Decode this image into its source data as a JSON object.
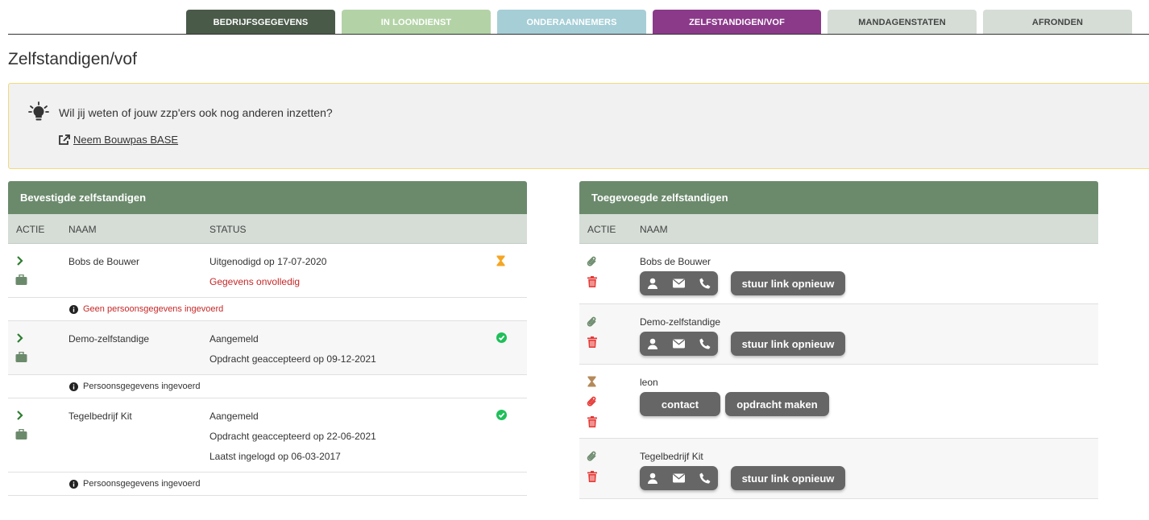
{
  "tabs": [
    {
      "label": "BEDRIJFSGEGEVENS"
    },
    {
      "label": "IN LOONDIENST"
    },
    {
      "label": "ONDERAANNEMERS"
    },
    {
      "label": "ZELFSTANDIGEN/VOF"
    },
    {
      "label": "MANDAGENSTATEN"
    },
    {
      "label": "AFRONDEN"
    }
  ],
  "page_title": "Zelfstandigen/vof",
  "notice": {
    "text": "Wil jij weten of jouw zzp'ers ook nog anderen inzetten?",
    "link": "Neem Bouwpas BASE"
  },
  "left_panel": {
    "title": "Bevestigde zelfstandigen",
    "columns": [
      "ACTIE",
      "NAAM",
      "STATUS"
    ],
    "rows": [
      {
        "name": "Bobs de Bouwer",
        "status": [
          "Uitgenodigd op 17-07-2020"
        ],
        "status_red": "Gegevens onvolledig",
        "note": "Geen persoonsgegevens ingevoerd"
      },
      {
        "name": "Demo-zelfstandige",
        "status": [
          "Aangemeld",
          "Opdracht geaccepteerd op 09-12-2021"
        ],
        "note": "Persoonsgegevens ingevoerd"
      },
      {
        "name": "Tegelbedrijf Kit",
        "status": [
          "Aangemeld",
          "Opdracht geaccepteerd op 22-06-2021",
          "Laatst ingelogd op 06-03-2017"
        ],
        "note": "Persoonsgegevens ingevoerd"
      }
    ]
  },
  "right_panel": {
    "title": "Toegevoegde zelfstandigen",
    "columns": [
      "ACTIE",
      "NAAM"
    ],
    "rows": [
      {
        "name": "Bobs de Bouwer",
        "button": "stuur link opnieuw"
      },
      {
        "name": "Demo-zelfstandige",
        "button": "stuur link opnieuw"
      },
      {
        "name": "leon",
        "button_contact": "contact",
        "button_opdracht": "opdracht maken"
      },
      {
        "name": "Tegelbedrijf Kit",
        "button": "stuur link opnieuw"
      }
    ]
  },
  "colors": {
    "header_green": "#6b8a6c",
    "tab_active": "#8b3a8a",
    "icon_green": "#2e7d32",
    "icon_red": "#e53935",
    "hourglass": "#f5a623",
    "check": "#1fbf5a"
  }
}
